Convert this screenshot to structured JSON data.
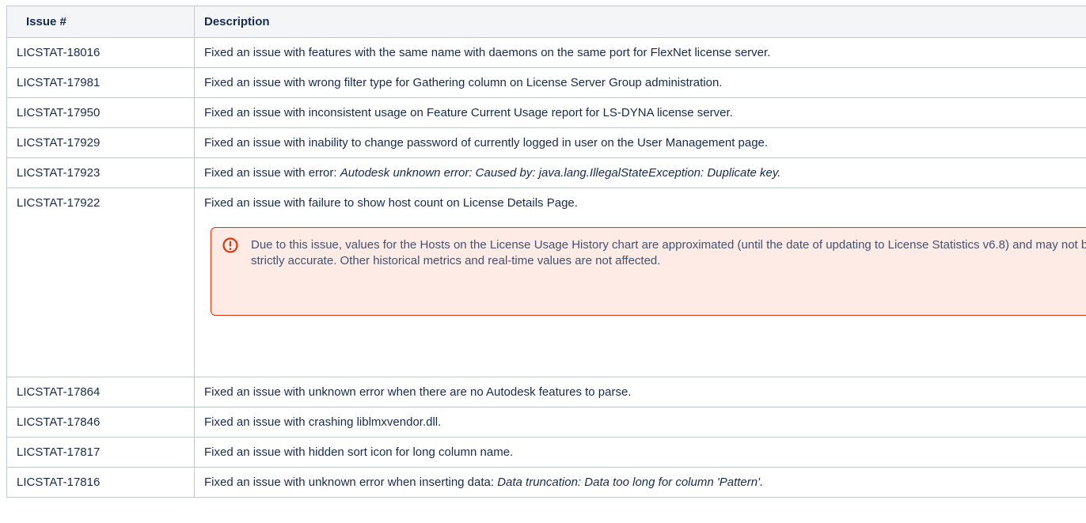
{
  "table": {
    "headers": {
      "issue": "Issue #",
      "description": "Description"
    },
    "rows": [
      {
        "issue": "LICSTAT-18016",
        "text": "Fixed an issue with features with the same name with daemons on the same port for FlexNet license server."
      },
      {
        "issue": "LICSTAT-17981",
        "text": "Fixed an issue with wrong filter type for Gathering column on License Server Group administration."
      },
      {
        "issue": "LICSTAT-17950",
        "text": "Fixed an issue with inconsistent usage on Feature Current Usage report for LS-DYNA license server."
      },
      {
        "issue": "LICSTAT-17929",
        "text": "Fixed an issue with inability to change password of currently logged in user on the User Management page."
      },
      {
        "issue": "LICSTAT-17923",
        "text": "Fixed an issue with error: ",
        "italic": "Autodesk unknown error: Caused by: java.lang.IllegalStateException: Duplicate key."
      },
      {
        "issue": "LICSTAT-17922",
        "text": "Fixed an issue with failure to show host count on License Details Page."
      },
      {
        "issue": "LICSTAT-17864",
        "text": "Fixed an issue with unknown error when there are no Autodesk features to parse."
      },
      {
        "issue": "LICSTAT-17846",
        "text": "Fixed an issue with crashing liblmxvendor.dll."
      },
      {
        "issue": "LICSTAT-17817",
        "text": "Fixed an issue with hidden sort icon for long column name."
      },
      {
        "issue": "LICSTAT-17816",
        "text": "Fixed an issue with unknown error when inserting data: ",
        "italic": "Data truncation: Data too long for column 'Pattern'."
      }
    ],
    "warning_panel": {
      "icon": "exclamation-circle-icon",
      "text": "Due to this issue, values for the Hosts on the License Usage History chart are approximated (until the date of updating to License Statistics v6.8) and may not be strictly accurate. Other historical metrics and real-time values are not affected."
    }
  },
  "colors": {
    "border": "#c1c7d0",
    "header_bg": "#f4f5f7",
    "warning_border": "#de350b",
    "warning_bg": "#ffebe6"
  }
}
